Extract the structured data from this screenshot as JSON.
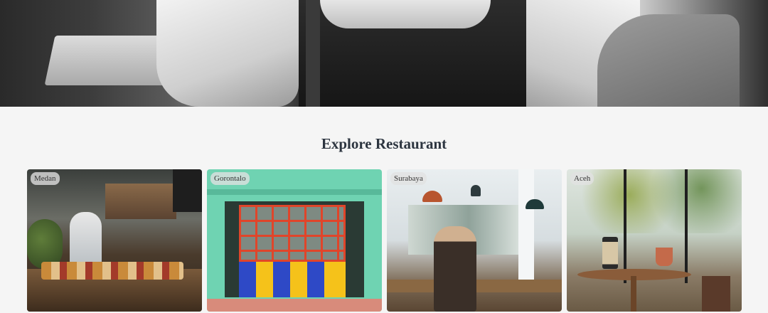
{
  "hero": {
    "image": "chef-hero-image"
  },
  "section": {
    "title": "Explore Restaurant"
  },
  "restaurants": [
    {
      "city": "Medan",
      "image": "kitchen-counter-photo"
    },
    {
      "city": "Gorontalo",
      "image": "mint-storefront-photo"
    },
    {
      "city": "Surabaya",
      "image": "cafe-interior-photo"
    },
    {
      "city": "Aceh",
      "image": "garden-terrace-photo"
    }
  ]
}
